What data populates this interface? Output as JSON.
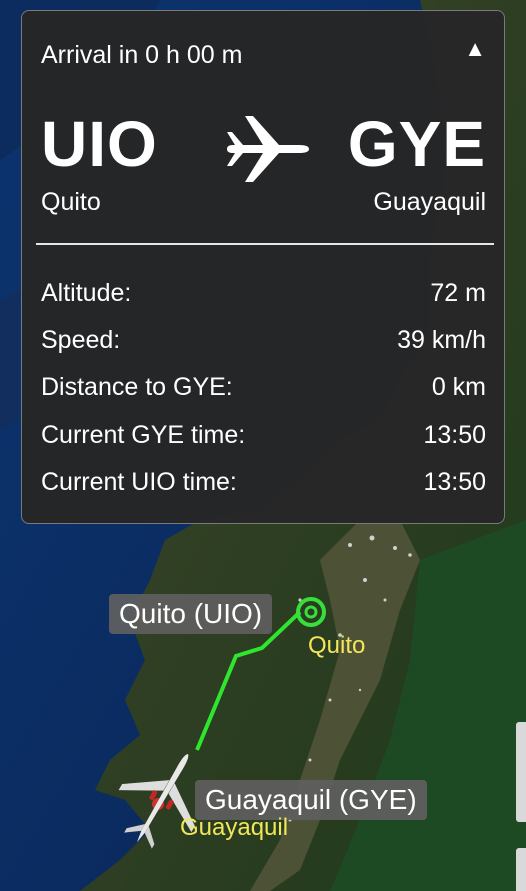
{
  "panel": {
    "arrival": "Arrival in 0 h 00 m",
    "collapse_icon": "▲",
    "origin": {
      "code": "UIO",
      "city": "Quito"
    },
    "destination": {
      "code": "GYE",
      "city": "Guayaquil"
    },
    "stats": [
      {
        "label": "Altitude:",
        "value": "72 m"
      },
      {
        "label": "Speed:",
        "value": "39 km/h"
      },
      {
        "label": "Distance to GYE:",
        "value": "0 km"
      },
      {
        "label": "Current GYE time:",
        "value": "13:50"
      },
      {
        "label": "Current UIO time:",
        "value": "13:50"
      }
    ]
  },
  "map": {
    "origin_pill": "Quito (UIO)",
    "destination_pill": "Guayaquil (GYE)",
    "origin_city_label": "Quito",
    "destination_city_label": "Guayaquil",
    "route_color": "#2ee62e",
    "origin_marker_color": "#36e03a"
  }
}
